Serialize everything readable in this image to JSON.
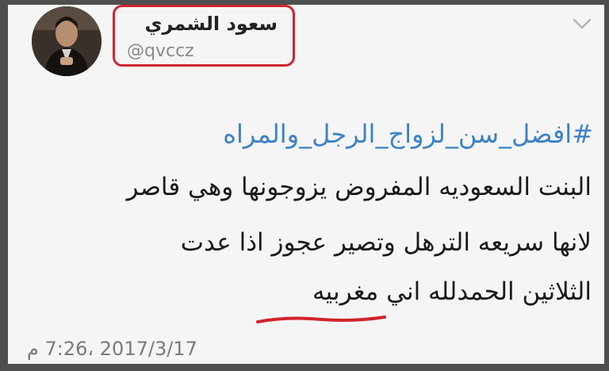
{
  "tweet": {
    "display_name": "سعود الشمري",
    "handle": "@qvccz",
    "hashtag": "#افضل_سن_لزواج_الرجل_والمراه",
    "lines": [
      "البنت السعوديه المفروض يزوجونها وهي قاصر",
      "لانها سريعه الترهل وتصير عجوز اذا عدت",
      "الثلاثين الحمدلله اني مغربيه"
    ],
    "timestamp": "2017/3/17 ،7:26 م"
  },
  "colors": {
    "hashtag": "#3d83c4",
    "annotation": "#d0242d",
    "text": "#1a1a1a",
    "muted": "#7a7a7a"
  },
  "icons": {
    "avatar": "profile-photo",
    "menu": "chevron-down-icon"
  }
}
